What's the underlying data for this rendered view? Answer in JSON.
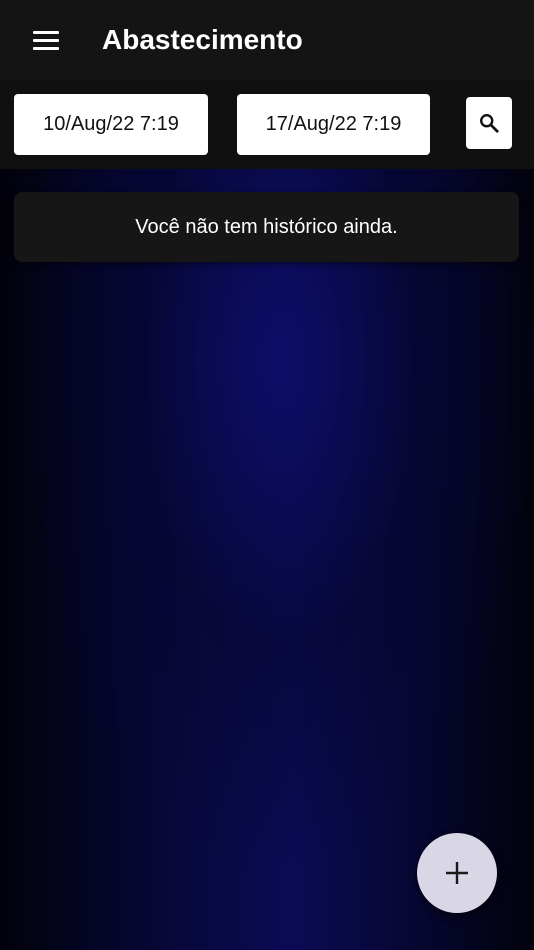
{
  "appbar": {
    "title": "Abastecimento",
    "menu_icon": "hamburger-menu-icon"
  },
  "filters": {
    "start_date": "10/Aug/22 7:19",
    "end_date": "17/Aug/22 7:19",
    "search_icon": "search-icon"
  },
  "history": {
    "empty_message": "Você não tem histórico ainda."
  },
  "fab": {
    "icon": "plus-icon"
  },
  "colors": {
    "appbar_bg": "#141414",
    "background_accent": "#0b0b55",
    "fab_bg": "#d9d6e6"
  }
}
